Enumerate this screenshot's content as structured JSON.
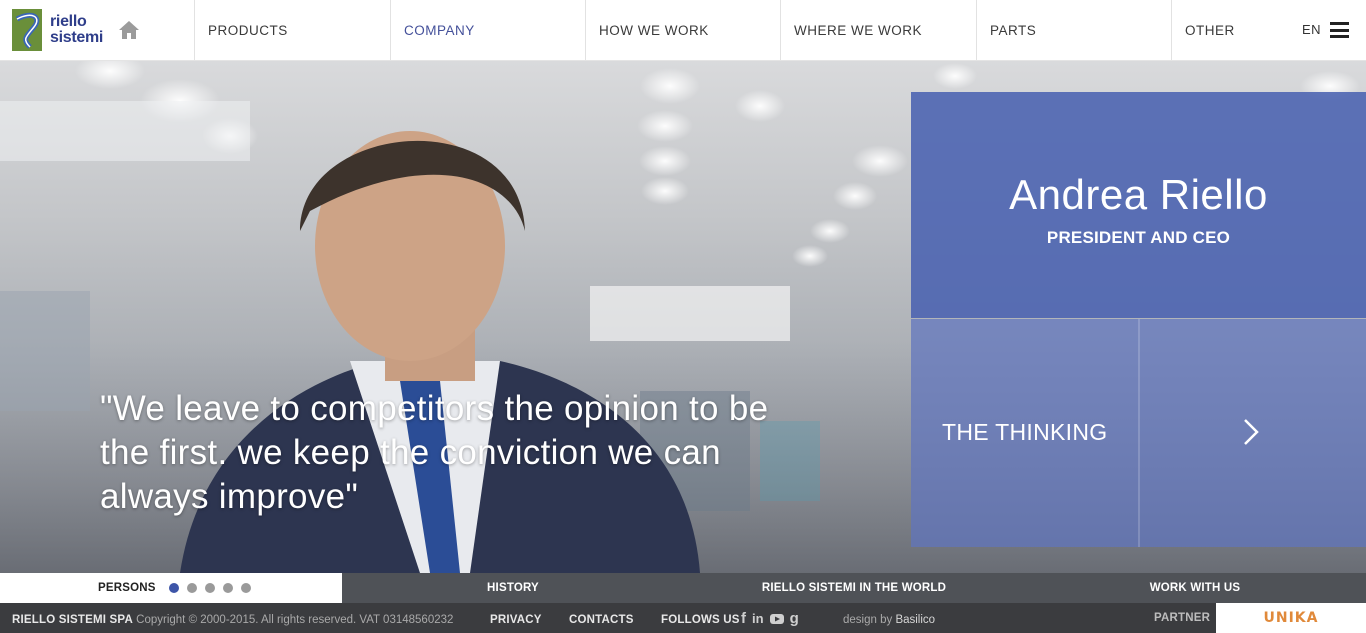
{
  "header": {
    "logo_text": [
      "riello",
      "sistemi"
    ],
    "nav": [
      {
        "label": "PRODUCTS",
        "active": false
      },
      {
        "label": "COMPANY",
        "active": true
      },
      {
        "label": "HOW WE WORK",
        "active": false
      },
      {
        "label": "WHERE WE WORK",
        "active": false
      },
      {
        "label": "PARTS",
        "active": false
      },
      {
        "label": "OTHER",
        "active": false
      }
    ],
    "language": "EN"
  },
  "hero": {
    "quote": "\"We leave to competitors the opinion to be the first. we keep the conviction we can always improve\"",
    "person_name": "Andrea Riello",
    "person_role": "PRESIDENT AND CEO",
    "link_label": "THE THINKING"
  },
  "tabs": {
    "items": [
      {
        "label": "PERSONS",
        "active": true
      },
      {
        "label": "HISTORY",
        "active": false
      },
      {
        "label": "RIELLO SISTEMI IN THE WORLD",
        "active": false
      },
      {
        "label": "WORK WITH US",
        "active": false
      }
    ],
    "slide_count": 5,
    "current_slide": 1
  },
  "footer": {
    "company": "RIELLO SISTEMI SPA",
    "copyright": "Copyright © 2000-2015. All rights reserved. VAT 03148560232",
    "privacy": "PRIVACY",
    "contacts": "CONTACTS",
    "follow": "FOLLOWS US",
    "social_icons": [
      "facebook-icon",
      "linkedin-icon",
      "youtube-icon",
      "googleplus-icon"
    ],
    "design_prefix": "design by",
    "designer": "Basilico",
    "partner": "PARTNER",
    "partner_logo_text": "UNIKA"
  },
  "colors": {
    "brand_blue": "#44509a",
    "panel_blue": "#4a62b0",
    "active_dot": "#3d55a8",
    "footer_bg": "#3b3c3f"
  }
}
